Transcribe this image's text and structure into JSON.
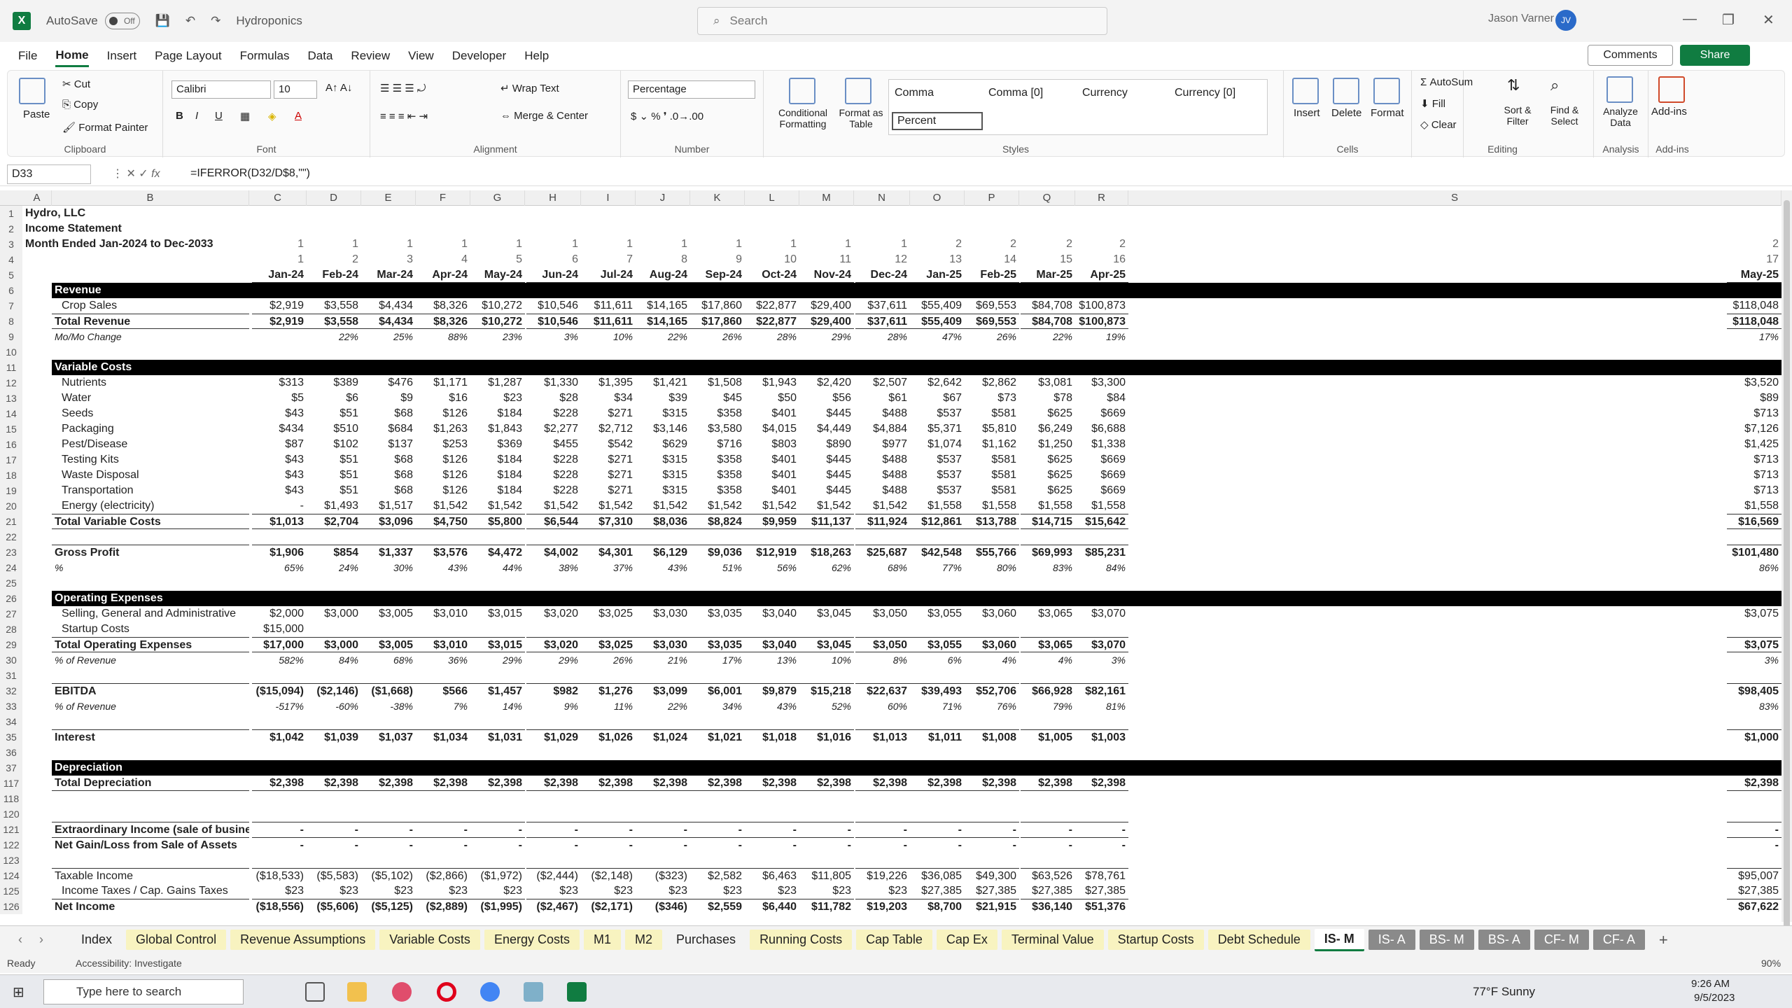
{
  "titlebar": {
    "autosave": "AutoSave",
    "toggle": "Off",
    "filename": "Hydroponics",
    "search_placeholder": "Search",
    "user": "Jason Varner",
    "initials": "JV"
  },
  "menu": [
    "File",
    "Home",
    "Insert",
    "Page Layout",
    "Formulas",
    "Data",
    "Review",
    "View",
    "Developer",
    "Help"
  ],
  "buttons": {
    "comments": "Comments",
    "share": "Share"
  },
  "ribbon": {
    "paste": "Paste",
    "cut": "Cut",
    "copy": "Copy",
    "format_painter": "Format Painter",
    "clipboard": "Clipboard",
    "font_name": "Calibri",
    "font_size": "10",
    "font": "Font",
    "wrap": "Wrap Text",
    "merge": "Merge & Center",
    "alignment": "Alignment",
    "number_format": "Percentage",
    "number": "Number",
    "cond_fmt": "Conditional Formatting",
    "fmt_table": "Format as Table",
    "styles": [
      "Comma",
      "Comma [0]",
      "Currency",
      "Currency [0]",
      "Percent"
    ],
    "styles_label": "Styles",
    "insert": "Insert",
    "delete": "Delete",
    "format": "Format",
    "cells": "Cells",
    "autosum": "AutoSum",
    "fill": "Fill",
    "clear": "Clear",
    "sort": "Sort & Filter",
    "find": "Find & Select",
    "editing": "Editing",
    "analyze": "Analyze Data",
    "analysis": "Analysis",
    "addins": "Add-ins",
    "addins_label": "Add-ins"
  },
  "formula_bar": {
    "cell": "D33",
    "formula": "=IFERROR(D32/D$8,\"\")"
  },
  "columns": [
    "A",
    "B",
    "C",
    "D",
    "E",
    "F",
    "G",
    "H",
    "I",
    "J",
    "K",
    "L",
    "M",
    "N",
    "O",
    "P",
    "Q",
    "R",
    "S"
  ],
  "header_rows": {
    "r1": "Hydro, LLC",
    "r2": "Income Statement",
    "r3": "Month Ended Jan-2024 to Dec-2033",
    "years": [
      "1",
      "1",
      "1",
      "1",
      "1",
      "1",
      "1",
      "1",
      "1",
      "1",
      "1",
      "1",
      "2",
      "2",
      "2",
      "2",
      "2"
    ],
    "months": [
      "1",
      "2",
      "3",
      "4",
      "5",
      "6",
      "7",
      "8",
      "9",
      "10",
      "11",
      "12",
      "13",
      "14",
      "15",
      "16",
      "17"
    ],
    "dates": [
      "Jan-24",
      "Feb-24",
      "Mar-24",
      "Apr-24",
      "May-24",
      "Jun-24",
      "Jul-24",
      "Aug-24",
      "Sep-24",
      "Oct-24",
      "Nov-24",
      "Dec-24",
      "Jan-25",
      "Feb-25",
      "Mar-25",
      "Apr-25",
      "May-25"
    ]
  },
  "rows": [
    {
      "n": "6",
      "label": "Revenue",
      "style": "black"
    },
    {
      "n": "7",
      "label": "Crop Sales",
      "ind": true,
      "v": [
        "$2,919",
        "$3,558",
        "$4,434",
        "$8,326",
        "$10,272",
        "$10,546",
        "$11,611",
        "$14,165",
        "$17,860",
        "$22,877",
        "$29,400",
        "$37,611",
        "$55,409",
        "$69,553",
        "$84,708",
        "$100,873",
        "$118,048"
      ]
    },
    {
      "n": "8",
      "label": "Total Revenue",
      "style": "bold topb botb",
      "v": [
        "$2,919",
        "$3,558",
        "$4,434",
        "$8,326",
        "$10,272",
        "$10,546",
        "$11,611",
        "$14,165",
        "$17,860",
        "$22,877",
        "$29,400",
        "$37,611",
        "$55,409",
        "$69,553",
        "$84,708",
        "$100,873",
        "$118,048"
      ]
    },
    {
      "n": "9",
      "label": "Mo/Mo Change",
      "style": "ital",
      "v": [
        "",
        "22%",
        "25%",
        "88%",
        "23%",
        "3%",
        "10%",
        "22%",
        "26%",
        "28%",
        "29%",
        "28%",
        "47%",
        "26%",
        "22%",
        "19%",
        "17%"
      ]
    },
    {
      "n": "10",
      "label": ""
    },
    {
      "n": "11",
      "label": "Variable Costs",
      "style": "black"
    },
    {
      "n": "12",
      "label": "Nutrients",
      "ind": true,
      "v": [
        "$313",
        "$389",
        "$476",
        "$1,171",
        "$1,287",
        "$1,330",
        "$1,395",
        "$1,421",
        "$1,508",
        "$1,943",
        "$2,420",
        "$2,507",
        "$2,642",
        "$2,862",
        "$3,081",
        "$3,300",
        "$3,520"
      ]
    },
    {
      "n": "13",
      "label": "Water",
      "ind": true,
      "v": [
        "$5",
        "$6",
        "$9",
        "$16",
        "$23",
        "$28",
        "$34",
        "$39",
        "$45",
        "$50",
        "$56",
        "$61",
        "$67",
        "$73",
        "$78",
        "$84",
        "$89"
      ]
    },
    {
      "n": "14",
      "label": "Seeds",
      "ind": true,
      "v": [
        "$43",
        "$51",
        "$68",
        "$126",
        "$184",
        "$228",
        "$271",
        "$315",
        "$358",
        "$401",
        "$445",
        "$488",
        "$537",
        "$581",
        "$625",
        "$669",
        "$713"
      ]
    },
    {
      "n": "15",
      "label": "Packaging",
      "ind": true,
      "v": [
        "$434",
        "$510",
        "$684",
        "$1,263",
        "$1,843",
        "$2,277",
        "$2,712",
        "$3,146",
        "$3,580",
        "$4,015",
        "$4,449",
        "$4,884",
        "$5,371",
        "$5,810",
        "$6,249",
        "$6,688",
        "$7,126"
      ]
    },
    {
      "n": "16",
      "label": "Pest/Disease",
      "ind": true,
      "v": [
        "$87",
        "$102",
        "$137",
        "$253",
        "$369",
        "$455",
        "$542",
        "$629",
        "$716",
        "$803",
        "$890",
        "$977",
        "$1,074",
        "$1,162",
        "$1,250",
        "$1,338",
        "$1,425"
      ]
    },
    {
      "n": "17",
      "label": "Testing Kits",
      "ind": true,
      "v": [
        "$43",
        "$51",
        "$68",
        "$126",
        "$184",
        "$228",
        "$271",
        "$315",
        "$358",
        "$401",
        "$445",
        "$488",
        "$537",
        "$581",
        "$625",
        "$669",
        "$713"
      ]
    },
    {
      "n": "18",
      "label": "Waste Disposal",
      "ind": true,
      "v": [
        "$43",
        "$51",
        "$68",
        "$126",
        "$184",
        "$228",
        "$271",
        "$315",
        "$358",
        "$401",
        "$445",
        "$488",
        "$537",
        "$581",
        "$625",
        "$669",
        "$713"
      ]
    },
    {
      "n": "19",
      "label": "Transportation",
      "ind": true,
      "v": [
        "$43",
        "$51",
        "$68",
        "$126",
        "$184",
        "$228",
        "$271",
        "$315",
        "$358",
        "$401",
        "$445",
        "$488",
        "$537",
        "$581",
        "$625",
        "$669",
        "$713"
      ]
    },
    {
      "n": "20",
      "label": "Energy (electricity)",
      "ind": true,
      "v": [
        "-",
        "$1,493",
        "$1,517",
        "$1,542",
        "$1,542",
        "$1,542",
        "$1,542",
        "$1,542",
        "$1,542",
        "$1,542",
        "$1,542",
        "$1,542",
        "$1,558",
        "$1,558",
        "$1,558",
        "$1,558",
        "$1,558"
      ]
    },
    {
      "n": "21",
      "label": "Total Variable Costs",
      "style": "bold topb botb",
      "v": [
        "$1,013",
        "$2,704",
        "$3,096",
        "$4,750",
        "$5,800",
        "$6,544",
        "$7,310",
        "$8,036",
        "$8,824",
        "$9,959",
        "$11,137",
        "$11,924",
        "$12,861",
        "$13,788",
        "$14,715",
        "$15,642",
        "$16,569"
      ]
    },
    {
      "n": "22",
      "label": ""
    },
    {
      "n": "23",
      "label": "Gross Profit",
      "style": "bold topb",
      "v": [
        "$1,906",
        "$854",
        "$1,337",
        "$3,576",
        "$4,472",
        "$4,002",
        "$4,301",
        "$6,129",
        "$9,036",
        "$12,919",
        "$18,263",
        "$25,687",
        "$42,548",
        "$55,766",
        "$69,993",
        "$85,231",
        "$101,480"
      ]
    },
    {
      "n": "24",
      "label": "%",
      "style": "ital",
      "v": [
        "65%",
        "24%",
        "30%",
        "43%",
        "44%",
        "38%",
        "37%",
        "43%",
        "51%",
        "56%",
        "62%",
        "68%",
        "77%",
        "80%",
        "83%",
        "84%",
        "86%"
      ]
    },
    {
      "n": "25",
      "label": ""
    },
    {
      "n": "26",
      "label": "Operating Expenses",
      "style": "black"
    },
    {
      "n": "27",
      "label": "Selling, General and Administrative",
      "ind": true,
      "v": [
        "$2,000",
        "$3,000",
        "$3,005",
        "$3,010",
        "$3,015",
        "$3,020",
        "$3,025",
        "$3,030",
        "$3,035",
        "$3,040",
        "$3,045",
        "$3,050",
        "$3,055",
        "$3,060",
        "$3,065",
        "$3,070",
        "$3,075"
      ]
    },
    {
      "n": "28",
      "label": "Startup Costs",
      "ind": true,
      "v": [
        "$15,000",
        "",
        "",
        "",
        "",
        "",
        "",
        "",
        "",
        "",
        "",
        "",
        "",
        "",
        "",
        "",
        ""
      ]
    },
    {
      "n": "29",
      "label": "Total Operating Expenses",
      "style": "bold topb botb",
      "v": [
        "$17,000",
        "$3,000",
        "$3,005",
        "$3,010",
        "$3,015",
        "$3,020",
        "$3,025",
        "$3,030",
        "$3,035",
        "$3,040",
        "$3,045",
        "$3,050",
        "$3,055",
        "$3,060",
        "$3,065",
        "$3,070",
        "$3,075"
      ]
    },
    {
      "n": "30",
      "label": "% of Revenue",
      "style": "ital",
      "v": [
        "582%",
        "84%",
        "68%",
        "36%",
        "29%",
        "29%",
        "26%",
        "21%",
        "17%",
        "13%",
        "10%",
        "8%",
        "6%",
        "4%",
        "4%",
        "3%",
        "3%"
      ]
    },
    {
      "n": "31",
      "label": ""
    },
    {
      "n": "32",
      "label": "EBITDA",
      "style": "bold topb",
      "v": [
        "($15,094)",
        "($2,146)",
        "($1,668)",
        "$566",
        "$1,457",
        "$982",
        "$1,276",
        "$3,099",
        "$6,001",
        "$9,879",
        "$15,218",
        "$22,637",
        "$39,493",
        "$52,706",
        "$66,928",
        "$82,161",
        "$98,405"
      ]
    },
    {
      "n": "33",
      "label": "% of Revenue",
      "style": "ital",
      "v": [
        "-517%",
        "-60%",
        "-38%",
        "7%",
        "14%",
        "9%",
        "11%",
        "22%",
        "34%",
        "43%",
        "52%",
        "60%",
        "71%",
        "76%",
        "79%",
        "81%",
        "83%"
      ]
    },
    {
      "n": "34",
      "label": ""
    },
    {
      "n": "35",
      "label": "Interest",
      "style": "bold topb",
      "v": [
        "$1,042",
        "$1,039",
        "$1,037",
        "$1,034",
        "$1,031",
        "$1,029",
        "$1,026",
        "$1,024",
        "$1,021",
        "$1,018",
        "$1,016",
        "$1,013",
        "$1,011",
        "$1,008",
        "$1,005",
        "$1,003",
        "$1,000"
      ]
    },
    {
      "n": "36",
      "label": ""
    },
    {
      "n": "37",
      "label": "Depreciation",
      "style": "black"
    },
    {
      "n": "117",
      "label": "Total Depreciation",
      "style": "bold botb",
      "v": [
        "$2,398",
        "$2,398",
        "$2,398",
        "$2,398",
        "$2,398",
        "$2,398",
        "$2,398",
        "$2,398",
        "$2,398",
        "$2,398",
        "$2,398",
        "$2,398",
        "$2,398",
        "$2,398",
        "$2,398",
        "$2,398",
        "$2,398"
      ]
    },
    {
      "n": "118",
      "label": ""
    },
    {
      "n": "120",
      "label": ""
    },
    {
      "n": "121",
      "label": "Extraordinary Income (sale of business)",
      "style": "bold topb",
      "v": [
        "-",
        "-",
        "-",
        "-",
        "-",
        "-",
        "-",
        "-",
        "-",
        "-",
        "-",
        "-",
        "-",
        "-",
        "-",
        "-",
        "-"
      ]
    },
    {
      "n": "122",
      "label": "Net Gain/Loss from Sale of Assets",
      "style": "bold topb",
      "v": [
        "-",
        "-",
        "-",
        "-",
        "-",
        "-",
        "-",
        "-",
        "-",
        "-",
        "-",
        "-",
        "-",
        "-",
        "-",
        "-",
        "-"
      ]
    },
    {
      "n": "123",
      "label": ""
    },
    {
      "n": "124",
      "label": "Taxable Income",
      "style": "topb",
      "v": [
        "($18,533)",
        "($5,583)",
        "($5,102)",
        "($2,866)",
        "($1,972)",
        "($2,444)",
        "($2,148)",
        "($323)",
        "$2,582",
        "$6,463",
        "$11,805",
        "$19,226",
        "$36,085",
        "$49,300",
        "$63,526",
        "$78,761",
        "$95,007"
      ]
    },
    {
      "n": "125",
      "label": "Income Taxes / Cap. Gains Taxes",
      "ind": true,
      "v": [
        "$23",
        "$23",
        "$23",
        "$23",
        "$23",
        "$23",
        "$23",
        "$23",
        "$23",
        "$23",
        "$23",
        "$23",
        "$27,385",
        "$27,385",
        "$27,385",
        "$27,385",
        "$27,385"
      ]
    },
    {
      "n": "126",
      "label": "Net Income",
      "style": "bold topb",
      "v": [
        "($18,556)",
        "($5,606)",
        "($5,125)",
        "($2,889)",
        "($1,995)",
        "($2,467)",
        "($2,171)",
        "($346)",
        "$2,559",
        "$6,440",
        "$11,782",
        "$19,203",
        "$8,700",
        "$21,915",
        "$36,140",
        "$51,376",
        "$67,622"
      ]
    }
  ],
  "sheet_tabs": [
    {
      "name": "Index",
      "k": "white"
    },
    {
      "name": "Global Control",
      "k": ""
    },
    {
      "name": "Revenue Assumptions",
      "k": ""
    },
    {
      "name": "Variable Costs",
      "k": ""
    },
    {
      "name": "Energy Costs",
      "k": ""
    },
    {
      "name": "M1",
      "k": ""
    },
    {
      "name": "M2",
      "k": ""
    },
    {
      "name": "Purchases",
      "k": "white"
    },
    {
      "name": "Running Costs",
      "k": ""
    },
    {
      "name": "Cap Table",
      "k": ""
    },
    {
      "name": "Cap Ex",
      "k": ""
    },
    {
      "name": "Terminal Value",
      "k": ""
    },
    {
      "name": "Startup Costs",
      "k": ""
    },
    {
      "name": "Debt Schedule",
      "k": ""
    },
    {
      "name": "IS- M",
      "k": "active"
    },
    {
      "name": "IS- A",
      "k": "grey"
    },
    {
      "name": "BS- M",
      "k": "grey"
    },
    {
      "name": "BS- A",
      "k": "grey"
    },
    {
      "name": "CF- M",
      "k": "grey"
    },
    {
      "name": "CF- A",
      "k": "grey"
    }
  ],
  "status": {
    "ready": "Ready",
    "accessibility": "Accessibility: Investigate",
    "zoom": "90%"
  },
  "taskbar": {
    "search": "Type here to search",
    "weather": "77°F  Sunny",
    "time": "9:26 AM",
    "date": "9/5/2023"
  }
}
